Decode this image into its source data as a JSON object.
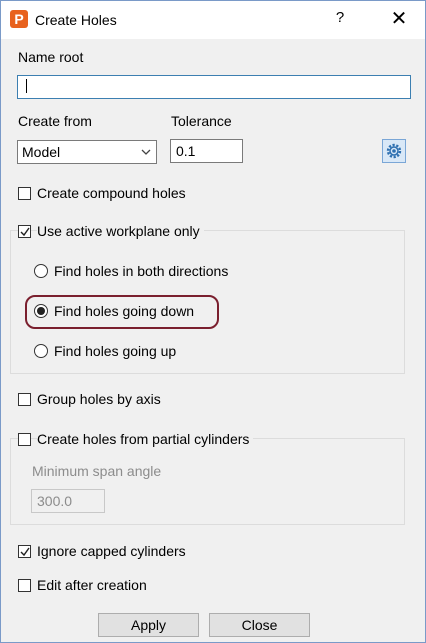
{
  "window": {
    "title": "Create Holes",
    "app_icon_letter": "P",
    "help_glyph": "?",
    "close_glyph": "✕"
  },
  "name_root": {
    "label": "Name root",
    "value": ""
  },
  "create_from": {
    "label": "Create from",
    "selected": "Model"
  },
  "tolerance": {
    "label": "Tolerance",
    "value": "0.1"
  },
  "options": {
    "compound_holes": {
      "label": "Create compound holes",
      "checked": false
    },
    "active_workplane": {
      "label": "Use active workplane only",
      "checked": true
    },
    "direction": {
      "both": "Find holes in both directions",
      "down": "Find holes going down",
      "up": "Find holes going up",
      "selected": "down"
    },
    "group_by_axis": {
      "label": "Group holes by axis",
      "checked": false
    },
    "partial_cylinders": {
      "label": "Create holes from partial cylinders",
      "checked": false
    },
    "min_span": {
      "label": "Minimum span angle",
      "value": "300.0"
    },
    "ignore_capped": {
      "label": "Ignore capped cylinders",
      "checked": true
    },
    "edit_after": {
      "label": "Edit after creation",
      "checked": false
    }
  },
  "buttons": {
    "apply": "Apply",
    "close": "Close"
  },
  "colors": {
    "highlight": "#7a1f2e",
    "input_focus": "#3c7fb1",
    "app_icon": "#e8621e"
  }
}
